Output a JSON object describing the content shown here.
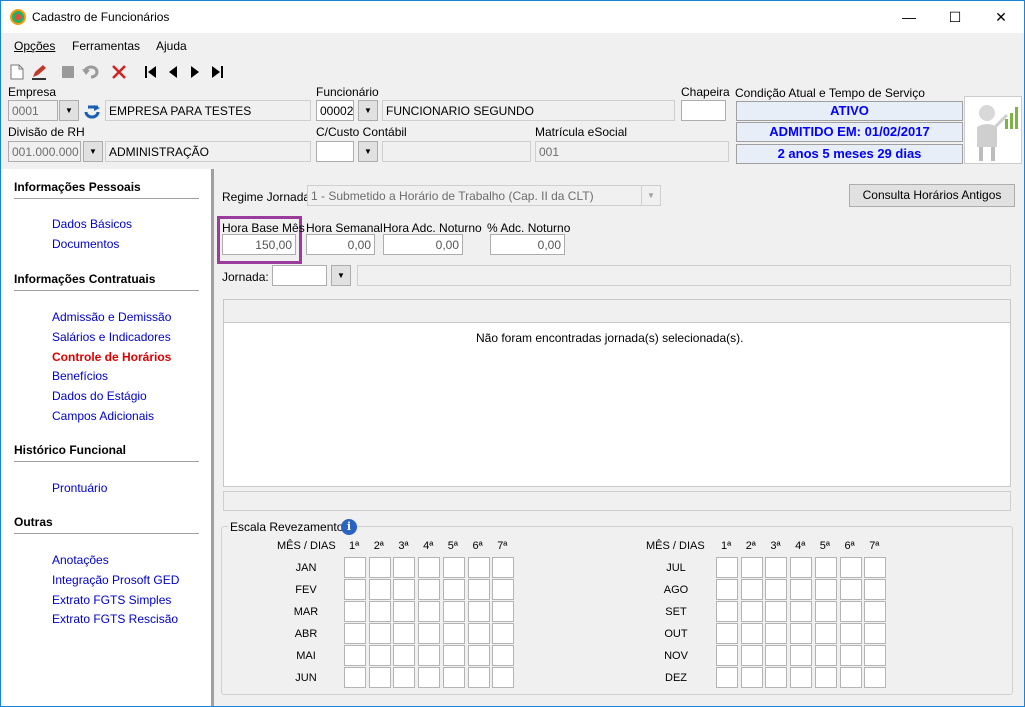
{
  "window": {
    "title": "Cadastro de Funcionários",
    "min": "—",
    "max": "☐",
    "close": "✕"
  },
  "menu": {
    "opcoes": "Opções",
    "ferramentas": "Ferramentas",
    "ajuda": "Ajuda"
  },
  "header": {
    "empresa_label": "Empresa",
    "empresa_code": "0001",
    "empresa_name": "EMPRESA PARA TESTES",
    "funcionario_label": "Funcionário",
    "funcionario_code": "00002",
    "funcionario_name": "FUNCIONARIO SEGUNDO",
    "chapeira_label": "Chapeira",
    "chapeira_value": "",
    "condicao_label": "Condição Atual e Tempo de Serviço",
    "status": "ATIVO",
    "admitido": "ADMITIDO EM: 01/02/2017",
    "tempo": "2 anos 5 meses 29 dias",
    "divisao_label": "Divisão de RH",
    "divisao_code": "001.000.000",
    "divisao_name": "ADMINISTRAÇÃO",
    "custo_label": "C/Custo Contábil",
    "custo_code": "",
    "custo_name": "",
    "matricula_label": "Matrícula eSocial",
    "matricula_value": "001"
  },
  "sidebar": {
    "sections": [
      {
        "title": "Informações Pessoais",
        "items": [
          "Dados Básicos",
          "Documentos"
        ]
      },
      {
        "title": "Informações Contratuais",
        "items": [
          "Admissão e Demissão",
          "Salários e Indicadores",
          "Controle de Horários",
          "Benefícios",
          "Dados do Estágio",
          "Campos Adicionais"
        ]
      },
      {
        "title": "Histórico Funcional",
        "items": [
          "Prontuário"
        ]
      },
      {
        "title": "Outras",
        "items": [
          "Anotações",
          "Integração Prosoft GED",
          "Extrato FGTS Simples",
          "Extrato FGTS Rescisão"
        ]
      }
    ],
    "active": "Controle de Horários"
  },
  "main": {
    "regime_label": "Regime Jornada",
    "regime_value": "1 - Submetido a Horário de Trabalho (Cap. II da CLT)",
    "consulta_button": "Consulta Horários Antigos",
    "hora_base_label": "Hora Base Mês",
    "hora_base_value": "150,00",
    "hora_semanal_label": "Hora Semanal",
    "hora_semanal_value": "0,00",
    "hora_adc_label": "Hora Adc. Noturno",
    "hora_adc_value": "0,00",
    "pct_adc_label": "% Adc. Noturno",
    "pct_adc_value": "0,00",
    "jornada_label": "Jornada:",
    "jornada_code": "",
    "jornada_desc": "",
    "empty_message": "Não foram encontradas jornada(s) selecionada(s)."
  },
  "escala": {
    "title": "Escala Revezamento",
    "header": "MÊS / DIAS",
    "days": [
      "1ª",
      "2ª",
      "3ª",
      "4ª",
      "5ª",
      "6ª",
      "7ª"
    ],
    "months_left": [
      "JAN",
      "FEV",
      "MAR",
      "ABR",
      "MAI",
      "JUN"
    ],
    "months_right": [
      "JUL",
      "AGO",
      "SET",
      "OUT",
      "NOV",
      "DEZ"
    ]
  }
}
